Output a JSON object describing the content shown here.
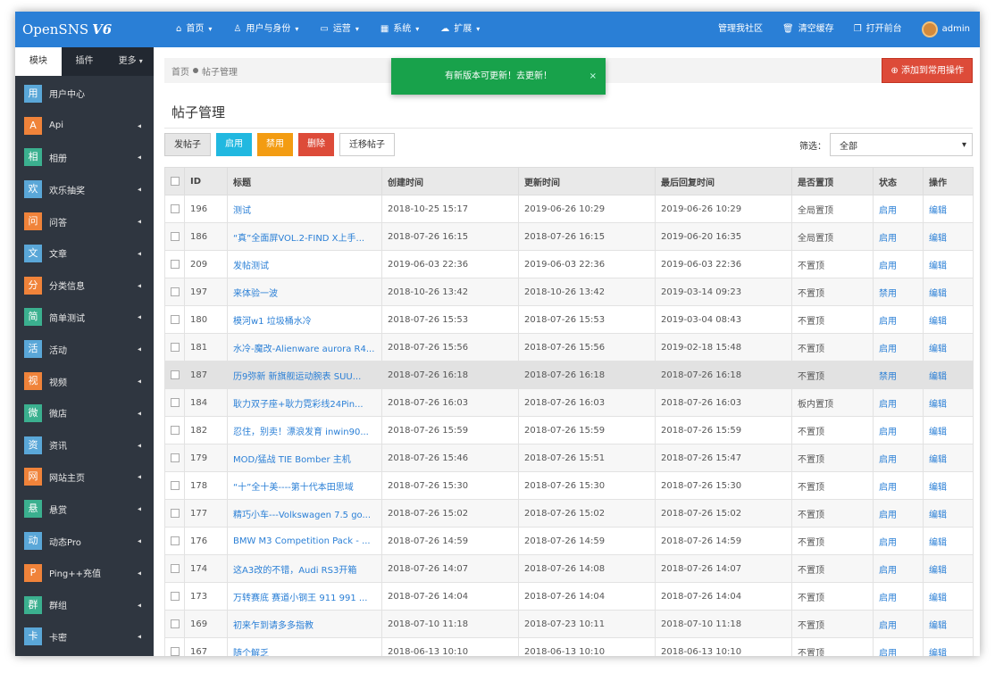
{
  "topbar": {
    "brand_main": "OpenSNS",
    "brand_version": "V6",
    "nav": [
      {
        "label": "首页",
        "icon": "home-icon",
        "glyph": "⌂"
      },
      {
        "label": "用户与身份",
        "icon": "user-icon",
        "glyph": "♙"
      },
      {
        "label": "运营",
        "icon": "monitor-icon",
        "glyph": "▭"
      },
      {
        "label": "系统",
        "icon": "windows-icon",
        "glyph": "▦"
      },
      {
        "label": "扩展",
        "icon": "cloud-icon",
        "glyph": "☁"
      }
    ],
    "right": [
      {
        "label": "管理我社区"
      },
      {
        "label": "清空缓存",
        "icon": "trash-icon",
        "glyph": "🗑"
      },
      {
        "label": "打开前台",
        "icon": "copy-icon",
        "glyph": "❐"
      },
      {
        "label": "admin",
        "icon": "avatar"
      }
    ]
  },
  "sidebar": {
    "tabs": [
      "模块",
      "插件",
      "更多"
    ],
    "items": [
      {
        "label": "用户中心",
        "char": "用",
        "color": "#5aa7d8",
        "arrow": false
      },
      {
        "label": "Api",
        "char": "A",
        "color": "#f0833a",
        "arrow": true
      },
      {
        "label": "相册",
        "char": "相",
        "color": "#3bb08f",
        "arrow": true
      },
      {
        "label": "欢乐抽奖",
        "char": "欢",
        "color": "#5aa7d8",
        "arrow": true
      },
      {
        "label": "问答",
        "char": "问",
        "color": "#f0833a",
        "arrow": true
      },
      {
        "label": "文章",
        "char": "文",
        "color": "#5aa7d8",
        "arrow": true
      },
      {
        "label": "分类信息",
        "char": "分",
        "color": "#f0833a",
        "arrow": true
      },
      {
        "label": "简单测试",
        "char": "简",
        "color": "#3bb08f",
        "arrow": true
      },
      {
        "label": "活动",
        "char": "活",
        "color": "#5aa7d8",
        "arrow": true
      },
      {
        "label": "视频",
        "char": "视",
        "color": "#f0833a",
        "arrow": true
      },
      {
        "label": "微店",
        "char": "微",
        "color": "#3bb08f",
        "arrow": true
      },
      {
        "label": "资讯",
        "char": "资",
        "color": "#5aa7d8",
        "arrow": true
      },
      {
        "label": "网站主页",
        "char": "网",
        "color": "#f0833a",
        "arrow": true
      },
      {
        "label": "悬赏",
        "char": "悬",
        "color": "#3bb08f",
        "arrow": true
      },
      {
        "label": "动态Pro",
        "char": "动",
        "color": "#5aa7d8",
        "arrow": true
      },
      {
        "label": "Ping++充值",
        "char": "P",
        "color": "#f0833a",
        "arrow": true
      },
      {
        "label": "群组",
        "char": "群",
        "color": "#3bb08f",
        "arrow": true
      },
      {
        "label": "卡密",
        "char": "卡",
        "color": "#5aa7d8",
        "arrow": true
      }
    ]
  },
  "breadcrumb": {
    "home": "首页",
    "current": "帖子管理"
  },
  "quick_button": "添加到常用操作",
  "toast": {
    "message": "有新版本可更新！去更新！",
    "close": "×"
  },
  "page_title": "帖子管理",
  "toolbar": {
    "post": "发帖子",
    "enable": "启用",
    "disable": "禁用",
    "delete": "删除",
    "move": "迁移帖子"
  },
  "filter": {
    "label": "筛选：",
    "value": "全部"
  },
  "table": {
    "headers": [
      "ID",
      "标题",
      "创建时间",
      "更新时间",
      "最后回复时间",
      "是否置顶",
      "状态",
      "操作"
    ],
    "rows": [
      {
        "id": "196",
        "title": "测试",
        "created": "2018-10-25 15:17",
        "updated": "2019-06-26 10:29",
        "last_reply": "2019-06-26 10:29",
        "top": "全局置顶",
        "status": "启用",
        "action": "编辑"
      },
      {
        "id": "186",
        "title": "“真”全面屏VOL.2-FIND X上手...",
        "created": "2018-07-26 16:15",
        "updated": "2018-07-26 16:15",
        "last_reply": "2019-06-20 16:35",
        "top": "全局置顶",
        "status": "启用",
        "action": "编辑"
      },
      {
        "id": "209",
        "title": "发帖测试",
        "created": "2019-06-03 22:36",
        "updated": "2019-06-03 22:36",
        "last_reply": "2019-06-03 22:36",
        "top": "不置顶",
        "status": "启用",
        "action": "编辑"
      },
      {
        "id": "197",
        "title": "来体验一波",
        "created": "2018-10-26 13:42",
        "updated": "2018-10-26 13:42",
        "last_reply": "2019-03-14 09:23",
        "top": "不置顶",
        "status": "禁用",
        "action": "编辑"
      },
      {
        "id": "180",
        "title": "模河w1 垃圾桶水冷",
        "created": "2018-07-26 15:53",
        "updated": "2018-07-26 15:53",
        "last_reply": "2019-03-04 08:43",
        "top": "不置顶",
        "status": "启用",
        "action": "编辑"
      },
      {
        "id": "181",
        "title": "水冷-魔改-Alienware aurora R4...",
        "created": "2018-07-26 15:56",
        "updated": "2018-07-26 15:56",
        "last_reply": "2019-02-18 15:48",
        "top": "不置顶",
        "status": "启用",
        "action": "编辑"
      },
      {
        "id": "187",
        "title": "历9弥新 新旗舰运动腕表 SUU...",
        "created": "2018-07-26 16:18",
        "updated": "2018-07-26 16:18",
        "last_reply": "2018-07-26 16:18",
        "top": "不置顶",
        "status": "禁用",
        "action": "编辑"
      },
      {
        "id": "184",
        "title": "耿力双子座+耿力霓彩线24Pin...",
        "created": "2018-07-26 16:03",
        "updated": "2018-07-26 16:03",
        "last_reply": "2018-07-26 16:03",
        "top": "板内置顶",
        "status": "启用",
        "action": "编辑"
      },
      {
        "id": "182",
        "title": "忍住，别卖！漂浪发育 inwin90...",
        "created": "2018-07-26 15:59",
        "updated": "2018-07-26 15:59",
        "last_reply": "2018-07-26 15:59",
        "top": "不置顶",
        "status": "启用",
        "action": "编辑"
      },
      {
        "id": "179",
        "title": "MOD/猛战 TIE Bomber 主机",
        "created": "2018-07-26 15:46",
        "updated": "2018-07-26 15:51",
        "last_reply": "2018-07-26 15:47",
        "top": "不置顶",
        "status": "启用",
        "action": "编辑"
      },
      {
        "id": "178",
        "title": "“十”全十美----第十代本田思域",
        "created": "2018-07-26 15:30",
        "updated": "2018-07-26 15:30",
        "last_reply": "2018-07-26 15:30",
        "top": "不置顶",
        "status": "启用",
        "action": "编辑"
      },
      {
        "id": "177",
        "title": "精巧小车---Volkswagen 7.5 go...",
        "created": "2018-07-26 15:02",
        "updated": "2018-07-26 15:02",
        "last_reply": "2018-07-26 15:02",
        "top": "不置顶",
        "status": "启用",
        "action": "编辑"
      },
      {
        "id": "176",
        "title": "BMW M3 Competition Pack - ...",
        "created": "2018-07-26 14:59",
        "updated": "2018-07-26 14:59",
        "last_reply": "2018-07-26 14:59",
        "top": "不置顶",
        "status": "启用",
        "action": "编辑"
      },
      {
        "id": "174",
        "title": "这A3改的不错，Audi RS3开箱",
        "created": "2018-07-26 14:07",
        "updated": "2018-07-26 14:08",
        "last_reply": "2018-07-26 14:07",
        "top": "不置顶",
        "status": "启用",
        "action": "编辑"
      },
      {
        "id": "173",
        "title": "万转赛底 赛道小钢王 911 991 ...",
        "created": "2018-07-26 14:04",
        "updated": "2018-07-26 14:04",
        "last_reply": "2018-07-26 14:04",
        "top": "不置顶",
        "status": "启用",
        "action": "编辑"
      },
      {
        "id": "169",
        "title": "初来乍到请多多指教",
        "created": "2018-07-10 11:18",
        "updated": "2018-07-23 10:11",
        "last_reply": "2018-07-10 11:18",
        "top": "不置顶",
        "status": "启用",
        "action": "编辑"
      },
      {
        "id": "167",
        "title": "随个解乏",
        "created": "2018-06-13 10:10",
        "updated": "2018-06-13 10:10",
        "last_reply": "2018-06-13 10:10",
        "top": "不置顶",
        "status": "启用",
        "action": "编辑"
      }
    ]
  }
}
